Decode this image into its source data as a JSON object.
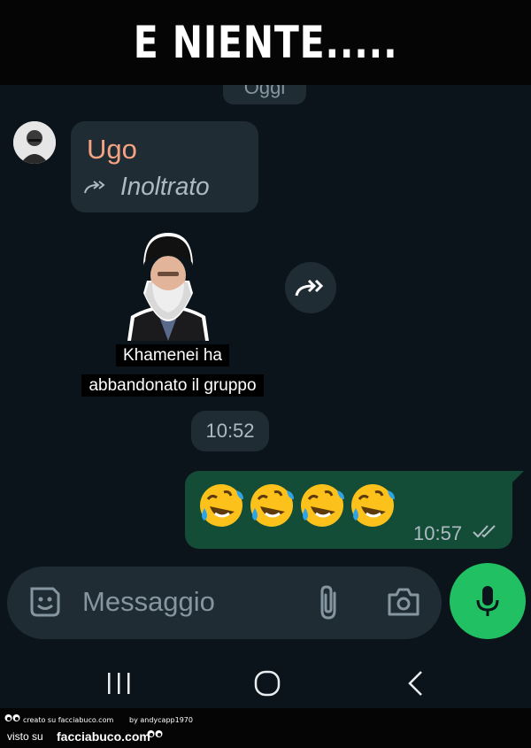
{
  "caption": {
    "text": "E NIENTE....."
  },
  "chat": {
    "date_separator": "Oggi",
    "incoming": {
      "sender": "Ugo",
      "forwarded_label": "Inoltrato",
      "sticker_caption_line1": "Khamenei ha",
      "sticker_caption_line2": "abbandonato il gruppo"
    },
    "time_separator": "10:52",
    "outgoing": {
      "emojis": [
        "rolling-on-floor-laughing",
        "rolling-on-floor-laughing",
        "rolling-on-floor-laughing",
        "rolling-on-floor-laughing"
      ],
      "time": "10:57",
      "status": "read"
    }
  },
  "composer": {
    "placeholder": "Messaggio"
  },
  "colors": {
    "background": "#0b141a",
    "incoming_bubble": "#1f2c34",
    "outgoing_bubble": "#144d37",
    "sender_name": "#f5a383",
    "mic_button": "#21c063",
    "read_ticks": "#aebac1"
  },
  "credits": {
    "created": "creato su facciabuco.com",
    "by": "by andycapp1970",
    "visto": "visto su",
    "site": "facciabuco.com"
  }
}
